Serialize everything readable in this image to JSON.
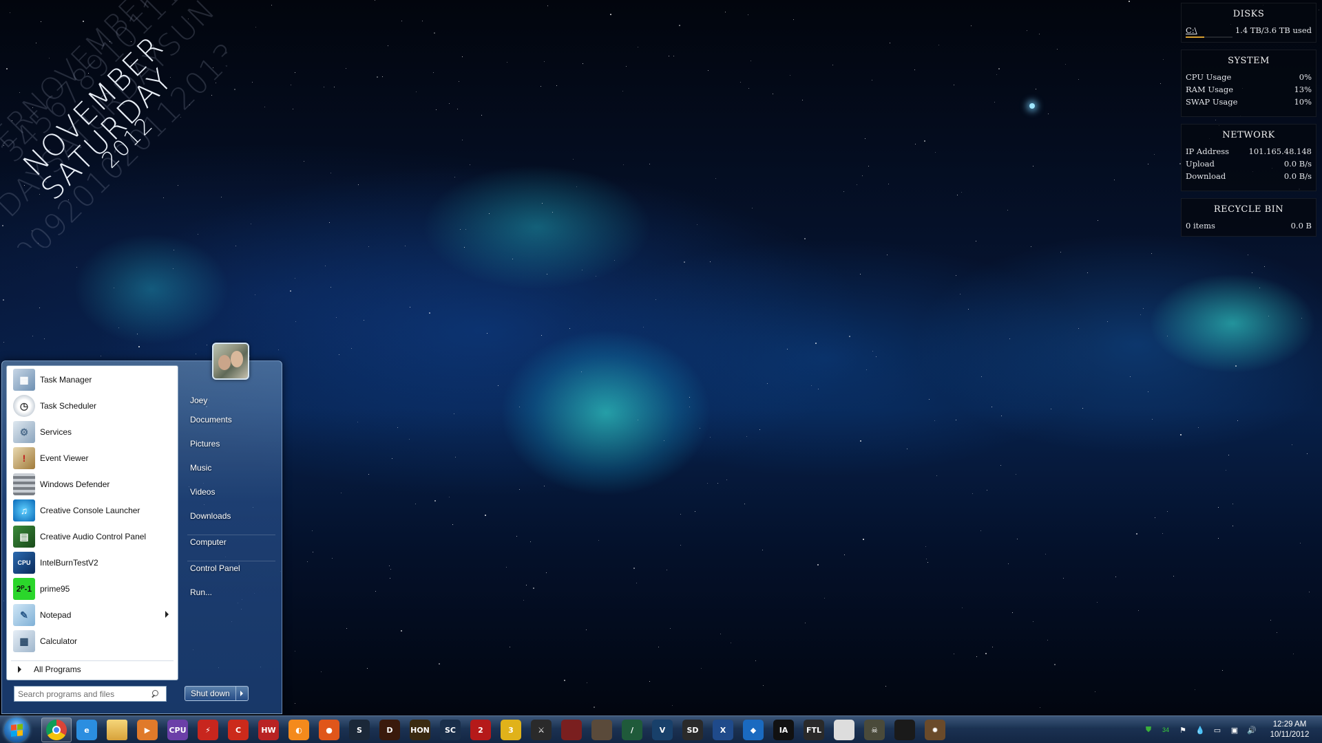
{
  "desktop": {
    "date_decoration": {
      "dim_line_1": "345678910111213",
      "main_line_1": "NOVEMBER",
      "dim_line_2": "DAYSATURDAYSUN",
      "main_line_2": "SATURDAY",
      "dim_line_3": "20092010201120132014",
      "main_line_3": "2012",
      "dim_line_4": "ERNOVEMBERDECEMBER"
    }
  },
  "widgets": {
    "disks": {
      "title": "DISKS",
      "drive": "C:\\",
      "usage": "1.4 TB/3.6 TB used",
      "used_fraction": 0.39
    },
    "system": {
      "title": "SYSTEM",
      "rows": [
        {
          "label": "CPU Usage",
          "value": "0%"
        },
        {
          "label": "RAM Usage",
          "value": "13%"
        },
        {
          "label": "SWAP Usage",
          "value": "10%"
        }
      ]
    },
    "network": {
      "title": "NETWORK",
      "rows": [
        {
          "label": "IP Address",
          "value": "101.165.48.148"
        },
        {
          "label": "Upload",
          "value": "0.0 B/s"
        },
        {
          "label": "Download",
          "value": "0.0 B/s"
        }
      ]
    },
    "recycle_bin": {
      "title": "RECYCLE BIN",
      "items": "0 items",
      "size": "0.0 B"
    }
  },
  "start_menu": {
    "programs": [
      {
        "label": "Task Manager",
        "icon": "task-manager-icon"
      },
      {
        "label": "Task Scheduler",
        "icon": "clock-icon"
      },
      {
        "label": "Services",
        "icon": "gears-icon"
      },
      {
        "label": "Event Viewer",
        "icon": "event-viewer-icon"
      },
      {
        "label": "Windows Defender",
        "icon": "defender-wall-icon"
      },
      {
        "label": "Creative Console Launcher",
        "icon": "creative-console-icon"
      },
      {
        "label": "Creative Audio Control Panel",
        "icon": "audio-card-icon"
      },
      {
        "label": "IntelBurnTestV2",
        "icon": "intel-chip-icon"
      },
      {
        "label": "prime95",
        "icon": "prime95-icon"
      },
      {
        "label": "Notepad",
        "icon": "notepad-icon"
      },
      {
        "label": "Calculator",
        "icon": "calculator-icon"
      }
    ],
    "all_programs": "All Programs",
    "search_placeholder": "Search programs and files",
    "right_links": [
      {
        "label": "Joey"
      },
      {
        "label": "Documents"
      },
      {
        "label": "Pictures"
      },
      {
        "label": "Music"
      },
      {
        "label": "Videos"
      },
      {
        "label": "Downloads"
      },
      {
        "label": "Computer"
      },
      {
        "label": "Control Panel"
      },
      {
        "label": "Run..."
      }
    ],
    "shutdown_label": "Shut down"
  },
  "taskbar": {
    "pinned": [
      {
        "name": "chrome-icon",
        "text": "",
        "color": "#e0402f",
        "active": true
      },
      {
        "name": "internet-explorer-icon",
        "text": "e",
        "color": "#2b8ee0",
        "active": false
      },
      {
        "name": "file-explorer-icon",
        "text": "",
        "color": "#e9c25a",
        "active": false
      },
      {
        "name": "media-player-icon",
        "text": "▶",
        "color": "#e07a2a",
        "active": false
      },
      {
        "name": "cpu-z-icon",
        "text": "CPU",
        "color": "#6b3fa8",
        "active": false
      },
      {
        "name": "flash-icon",
        "text": "⚡",
        "color": "#c8261e",
        "active": false
      },
      {
        "name": "ccleaner-icon",
        "text": "C",
        "color": "#cc2a1b",
        "active": false
      },
      {
        "name": "hwmonitor-icon",
        "text": "HW",
        "color": "#b92323",
        "active": false
      },
      {
        "name": "origin-icon",
        "text": "◐",
        "color": "#f48a1c",
        "active": false
      },
      {
        "name": "firefox-icon",
        "text": "●",
        "color": "#e0561a",
        "active": false
      },
      {
        "name": "steam-icon",
        "text": "S",
        "color": "#1b2838",
        "active": false
      },
      {
        "name": "diablo-icon",
        "text": "D",
        "color": "#3a1a0c",
        "active": false
      },
      {
        "name": "hon-icon",
        "text": "HON",
        "color": "#3a2a10",
        "active": false
      },
      {
        "name": "starcraft-icon",
        "text": "SC",
        "color": "#1a2f4a",
        "active": false
      },
      {
        "name": "guild-wars-2-icon",
        "text": "2",
        "color": "#b51a1a",
        "active": false
      },
      {
        "name": "game-3-icon",
        "text": "3",
        "color": "#e0b21a",
        "active": false
      },
      {
        "name": "assassins-creed-icon",
        "text": "⚔",
        "color": "#2a2a2a",
        "active": false
      },
      {
        "name": "game-portrait-icon",
        "text": "",
        "color": "#7a1f1f",
        "active": false
      },
      {
        "name": "borderlands-icon",
        "text": "",
        "color": "#5a4a3a",
        "active": false
      },
      {
        "name": "sword-icon",
        "text": "/",
        "color": "#1f5a3a",
        "active": false
      },
      {
        "name": "shield-v-icon",
        "text": "V",
        "color": "#18406a",
        "active": false
      },
      {
        "name": "sleeping-dogs-icon",
        "text": "SD",
        "color": "#2a2a2a",
        "active": false
      },
      {
        "name": "x-blade-icon",
        "text": "X",
        "color": "#1f4a8a",
        "active": false
      },
      {
        "name": "crystal-icon",
        "text": "◆",
        "color": "#1a6ac0",
        "active": false
      },
      {
        "name": "i-am-alive-icon",
        "text": "IA",
        "color": "#111111",
        "active": false
      },
      {
        "name": "ftl-icon",
        "text": "FTL",
        "color": "#2a2a2a",
        "active": false
      },
      {
        "name": "game-white-icon",
        "text": "",
        "color": "#dddddd",
        "active": false
      },
      {
        "name": "skull-icon",
        "text": "☠",
        "color": "#4a4a3a",
        "active": false
      },
      {
        "name": "game-dark-icon",
        "text": "",
        "color": "#1a1a1a",
        "active": false
      },
      {
        "name": "game-emblem-icon",
        "text": "✹",
        "color": "#6a4a2a",
        "active": false
      }
    ],
    "clock_time": "12:29 AM",
    "clock_date": "10/11/2012"
  }
}
